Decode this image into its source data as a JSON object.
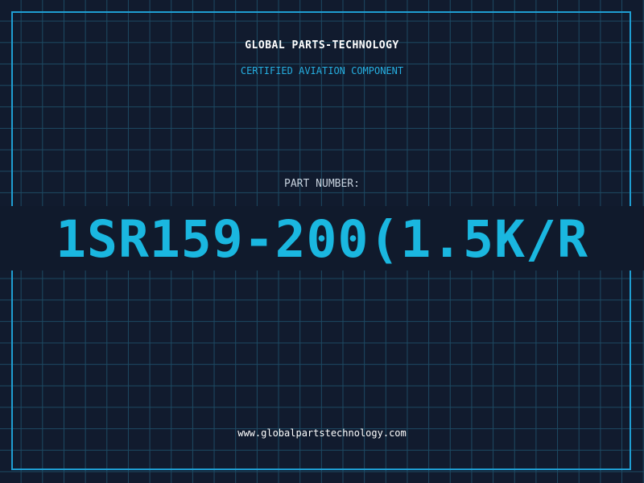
{
  "header": {
    "brand": "GLOBAL PARTS-TECHNOLOGY",
    "tagline": "CERTIFIED AVIATION COMPONENT"
  },
  "part": {
    "label": "PART NUMBER:",
    "number": "1SR159-200(1.5K/R"
  },
  "footer": {
    "website": "www.globalpartstechnology.com"
  },
  "colors": {
    "background": "#111b2e",
    "grid": "#1d4a63",
    "frame": "#1f9ed2",
    "accent": "#1ab7e0",
    "text": "#ffffff"
  }
}
